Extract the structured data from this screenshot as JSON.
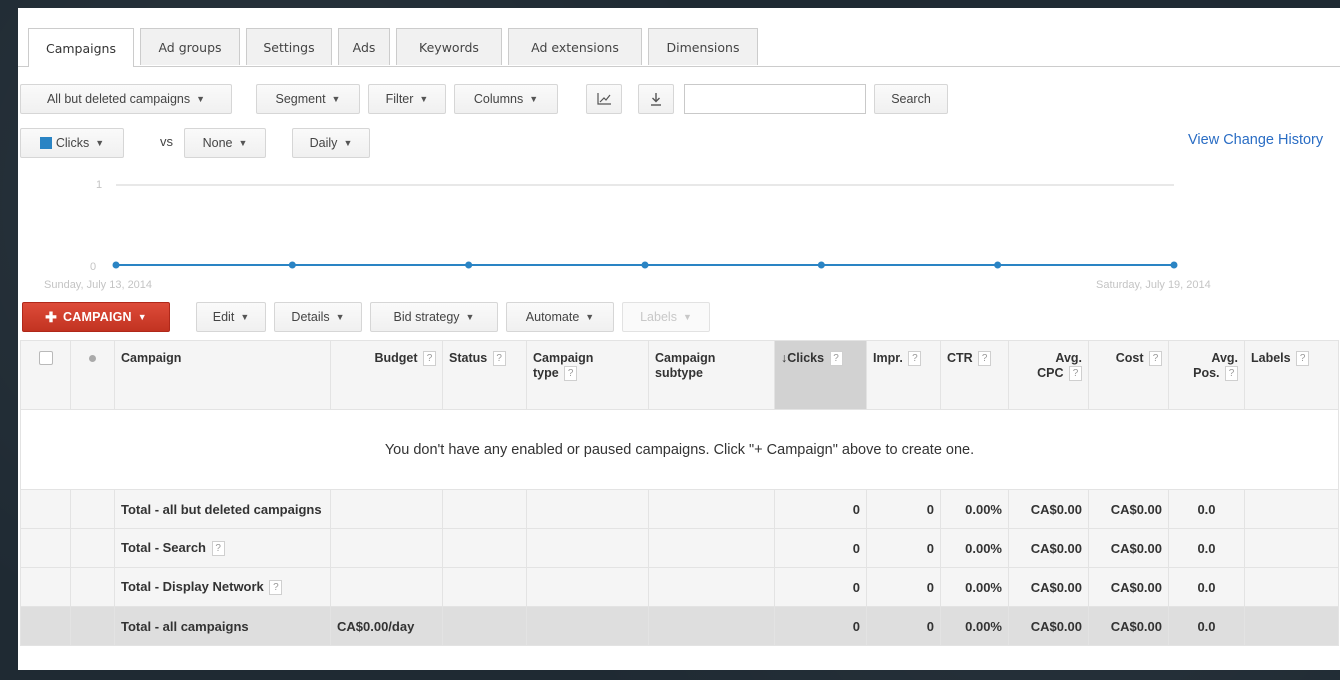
{
  "tabs": [
    "Campaigns",
    "Ad groups",
    "Settings",
    "Ads",
    "Keywords",
    "Ad extensions",
    "Dimensions"
  ],
  "toolbar": {
    "campaign_filter": "All but deleted campaigns",
    "segment": "Segment",
    "filter": "Filter",
    "columns": "Columns",
    "search_placeholder": "",
    "search_button": "Search"
  },
  "chart_controls": {
    "metric1": "Clicks",
    "vs": "vs",
    "metric2": "None",
    "period": "Daily",
    "view_change_history": "View Change History"
  },
  "chart_data": {
    "type": "line",
    "x": [
      "Sunday, July 13, 2014",
      "",
      "",
      "",
      "",
      "",
      "Saturday, July 19, 2014"
    ],
    "series": [
      {
        "values": [
          0,
          0,
          0,
          0,
          0,
          0,
          0
        ]
      }
    ],
    "ylim": [
      0,
      1
    ],
    "yticks": [
      "1",
      "0"
    ],
    "x_start_label": "Sunday, July 13, 2014",
    "x_end_label": "Saturday, July 19, 2014",
    "line_color": "#2a84c4"
  },
  "actions": {
    "add_campaign": "CAMPAIGN",
    "edit": "Edit",
    "details": "Details",
    "bid_strategy": "Bid strategy",
    "automate": "Automate",
    "labels": "Labels"
  },
  "table": {
    "headers": {
      "campaign": "Campaign",
      "budget": "Budget",
      "status": "Status",
      "campaign_type_1": "Campaign",
      "campaign_type_2": "type",
      "campaign_subtype_1": "Campaign",
      "campaign_subtype_2": "subtype",
      "clicks": "Clicks",
      "impr": "Impr.",
      "ctr": "CTR",
      "avg_cpc_1": "Avg.",
      "avg_cpc_2": "CPC",
      "cost": "Cost",
      "avg_pos_1": "Avg.",
      "avg_pos_2": "Pos.",
      "labels": "Labels"
    },
    "empty_message": "You don't have any enabled or paused campaigns. Click \"+ Campaign\" above to create one.",
    "totals": [
      {
        "name": "Total - all but deleted campaigns",
        "budget": "",
        "clicks": "0",
        "impr": "0",
        "ctr": "0.00%",
        "avg_cpc": "CA$0.00",
        "cost": "CA$0.00",
        "avg_pos": "0.0"
      },
      {
        "name": "Total - Search",
        "budget": "",
        "clicks": "0",
        "impr": "0",
        "ctr": "0.00%",
        "avg_cpc": "CA$0.00",
        "cost": "CA$0.00",
        "avg_pos": "0.0"
      },
      {
        "name": "Total - Display Network",
        "budget": "",
        "clicks": "0",
        "impr": "0",
        "ctr": "0.00%",
        "avg_cpc": "CA$0.00",
        "cost": "CA$0.00",
        "avg_pos": "0.0"
      },
      {
        "name": "Total - all campaigns",
        "budget": "CA$0.00/day",
        "clicks": "0",
        "impr": "0",
        "ctr": "0.00%",
        "avg_cpc": "CA$0.00",
        "cost": "CA$0.00",
        "avg_pos": "0.0"
      }
    ]
  }
}
